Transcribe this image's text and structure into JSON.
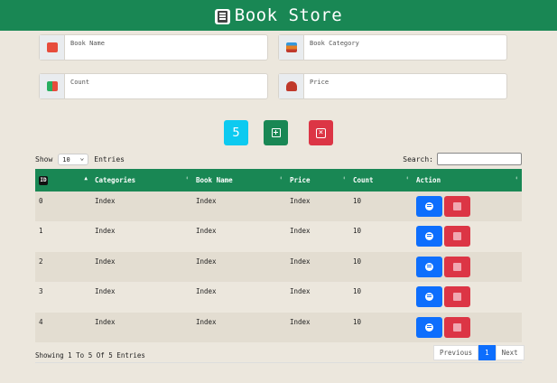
{
  "header": {
    "title": "Book Store",
    "icon": "book-icon"
  },
  "form": {
    "book_name_placeholder": "Book Name",
    "book_category_placeholder": "Book Category",
    "count_placeholder": "Count",
    "price_placeholder": "Price"
  },
  "toolbar": {
    "count_value": "5"
  },
  "table_controls": {
    "show_label": "Show",
    "page_length": "10",
    "entries_label": "Entries",
    "search_label": "Search:"
  },
  "table": {
    "headers": [
      "Categories",
      "Book Name",
      "Price",
      "Count",
      "Action"
    ],
    "id_header": "ID",
    "rows": [
      {
        "id": "0",
        "category": "Index",
        "book_name": "Index",
        "price": "Index",
        "count": "10"
      },
      {
        "id": "1",
        "category": "Index",
        "book_name": "Index",
        "price": "Index",
        "count": "10"
      },
      {
        "id": "2",
        "category": "Index",
        "book_name": "Index",
        "price": "Index",
        "count": "10"
      },
      {
        "id": "3",
        "category": "Index",
        "book_name": "Index",
        "price": "Index",
        "count": "10"
      },
      {
        "id": "4",
        "category": "Index",
        "book_name": "Index",
        "price": "Index",
        "count": "10"
      }
    ]
  },
  "footer": {
    "info": "Showing 1 To 5 Of 5 Entries",
    "previous": "Previous",
    "page": "1",
    "next": "Next"
  },
  "colors": {
    "brand": "#198754",
    "info": "#0dcaf0",
    "danger": "#dc3545",
    "primary": "#0d6efd",
    "background": "#ece7dd"
  }
}
